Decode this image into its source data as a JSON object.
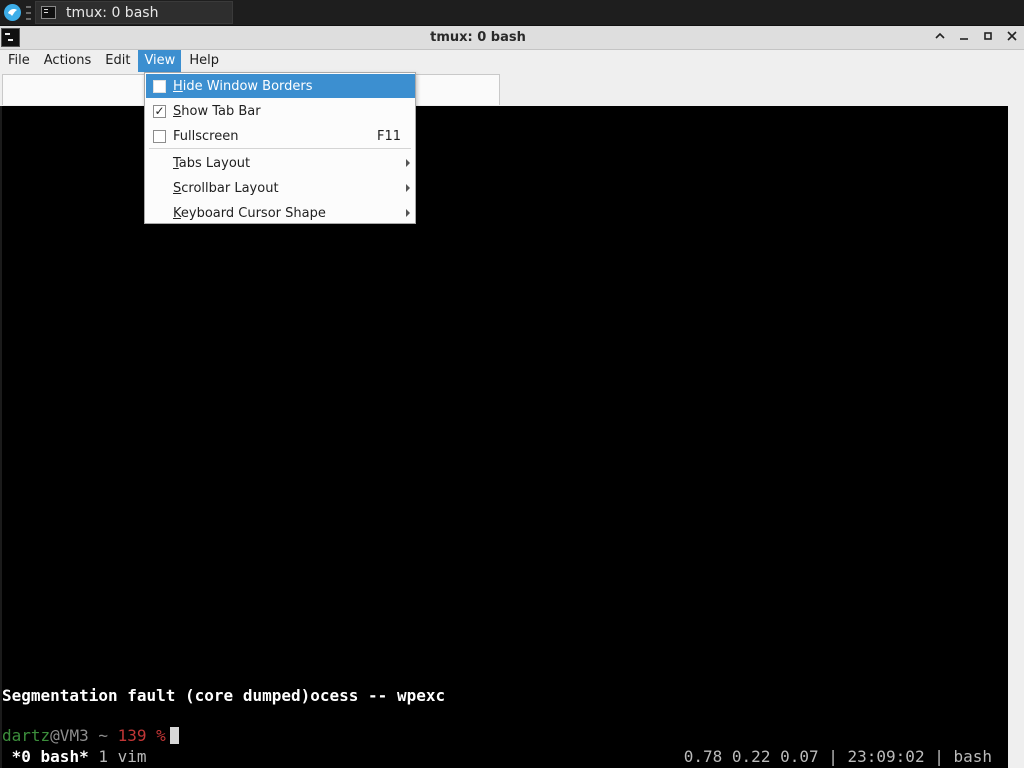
{
  "taskbar": {
    "task_title": "tmux: 0 bash"
  },
  "window": {
    "title": "tmux: 0 bash",
    "buttons": {
      "maximize_up": "^",
      "minimize": "–",
      "restore": "▫",
      "close": "✕"
    }
  },
  "menubar": {
    "items": [
      "File",
      "Actions",
      "Edit",
      "View",
      "Help"
    ],
    "active": "View"
  },
  "view_menu": {
    "items": [
      {
        "first": "H",
        "rest": "ide Window Borders",
        "type": "check",
        "checked": false,
        "highlighted": true
      },
      {
        "first": "S",
        "rest": "how Tab Bar",
        "type": "check",
        "checked": true
      },
      {
        "first": "",
        "rest": "Fullscreen",
        "type": "check",
        "checked": false,
        "shortcut": "F11"
      },
      {
        "first": "T",
        "rest": "abs Layout",
        "type": "submenu"
      },
      {
        "first": "S",
        "rest": "crollbar Layout",
        "type": "submenu"
      },
      {
        "first": "K",
        "rest": "eyboard Cursor Shape",
        "type": "submenu"
      }
    ],
    "check_mark": "✓"
  },
  "terminal": {
    "segfault_line": "Segmentation fault (core dumped)ocess -- wpexc",
    "prompt": {
      "user": "dartz",
      "at_host": "@VM3",
      "cwd": " ~ ",
      "exit_code": "139",
      "symbol": " %"
    },
    "status": {
      "current_window": "*0 bash*",
      "other_window": " 1 vim",
      "right": "0.78 0.22 0.07 | 23:09:02 | bash"
    }
  },
  "colors": {
    "accent": "#3c8fd0",
    "prompt_user": "#3c8f3c",
    "prompt_error": "#c23636",
    "terminal_bg": "#000000"
  }
}
